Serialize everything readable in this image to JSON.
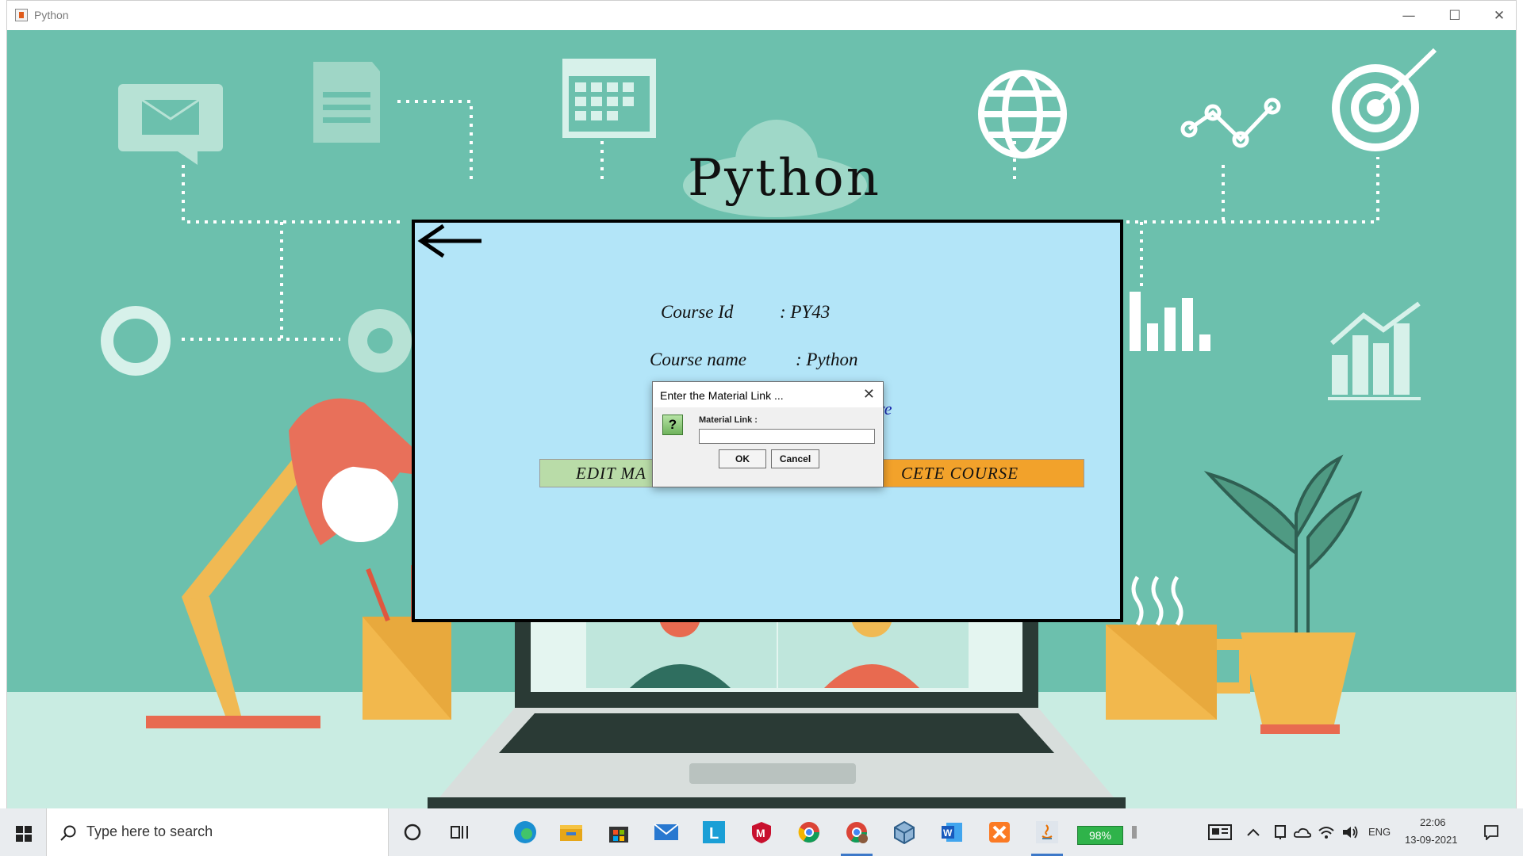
{
  "window": {
    "title": "Python",
    "controls": {
      "minimize": "—",
      "maximize": "☐",
      "close": "✕"
    }
  },
  "scene": {
    "heading": "Python"
  },
  "panel": {
    "course_id_label": "Course Id",
    "course_id_value": ": PY43",
    "course_name_label": "Course name",
    "course_name_value": ": Python",
    "material_link_fragment": "re",
    "edit_button_label": "EDIT MA",
    "delete_button_label": "CETE COURSE"
  },
  "dialog": {
    "title": "Enter the Material Link ...",
    "close_glyph": "✕",
    "question_glyph": "?",
    "field_label": "Material Link :",
    "field_value": "",
    "ok_label": "OK",
    "cancel_label": "Cancel"
  },
  "taskbar": {
    "search_placeholder": "Type here to search",
    "battery_percent": "98%",
    "language": "ENG",
    "time": "22:06",
    "date": "13-09-2021",
    "icons": [
      "start-icon",
      "search-icon",
      "cortana-icon",
      "task-view-icon",
      "edge-icon",
      "file-explorer-icon",
      "store-icon",
      "mail-icon",
      "app-l-icon",
      "mcafee-icon",
      "chrome-icon",
      "chrome-profile-icon",
      "virtualbox-icon",
      "word-icon",
      "xampp-icon",
      "java-icon",
      "battery-icon",
      "news-icon",
      "chevron-up-icon",
      "meet-icon",
      "onedrive-icon",
      "wifi-icon",
      "volume-icon",
      "notification-icon"
    ]
  },
  "colors": {
    "scene_bg": "#6cc0ad",
    "panel_bg": "#b3e5f8",
    "edit_button_bg": "#b9dca8",
    "delete_button_bg": "#f2a22b",
    "link_color": "#1a2bb0"
  }
}
